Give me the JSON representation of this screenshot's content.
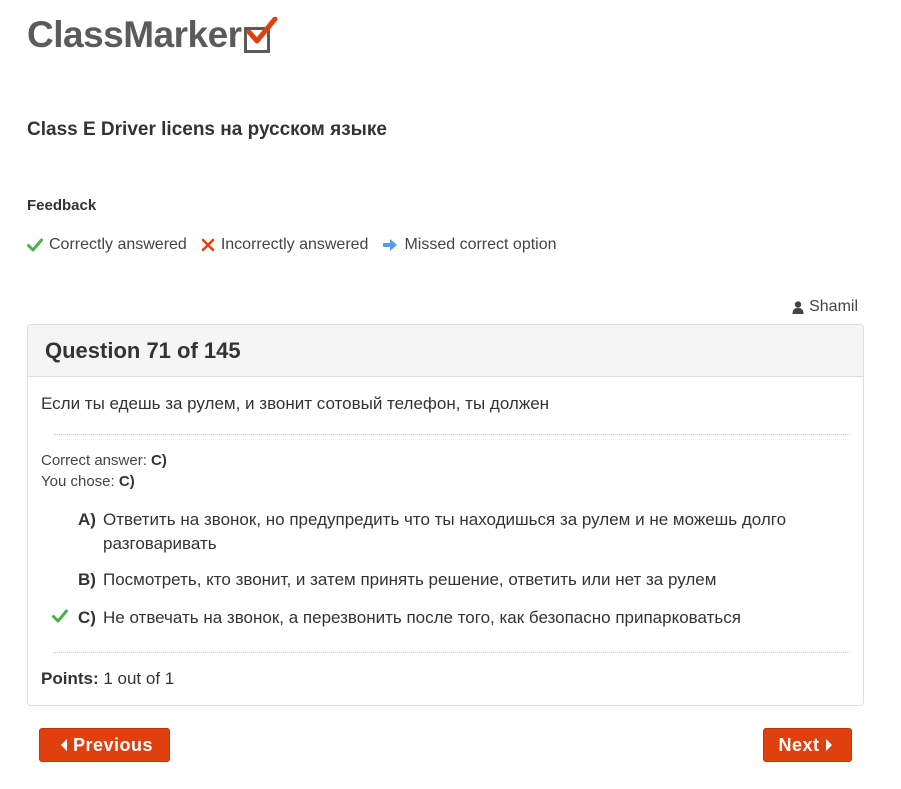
{
  "brand": {
    "name": "ClassMarker",
    "check_color": "#e0400e",
    "text_color": "#5b5b5b"
  },
  "test": {
    "title": "Class E Driver licens на русском языке"
  },
  "feedback": {
    "heading": "Feedback",
    "legend": [
      {
        "icon": "check-icon",
        "label": "Correctly answered",
        "color": "#4cae4c"
      },
      {
        "icon": "cross-icon",
        "label": "Incorrectly answered",
        "color": "#e0400e"
      },
      {
        "icon": "arrow-right-icon",
        "label": "Missed correct option",
        "color": "#4f9fe8"
      }
    ]
  },
  "user": {
    "icon": "user-icon",
    "name": "Shamil"
  },
  "question": {
    "heading": "Question 71 of 145",
    "text": "Если ты едешь за рулем, и звонит сотовый телефон, ты должен",
    "correct_answer_label": "Correct answer:",
    "correct_answer_value": "C)",
    "you_chose_label": "You chose:",
    "you_chose_value": "C)",
    "options": [
      {
        "letter": "A)",
        "text": "Ответить на звонок, но предупредить что ты находишься за рулем и не можешь долго разговаривать",
        "status": ""
      },
      {
        "letter": "B)",
        "text": "Посмотреть, кто звонит, и затем принять решение, ответить или нет за рулем",
        "status": ""
      },
      {
        "letter": "C)",
        "text": "Не отвечать на звонок, а перезвонить после того, как безопасно припарковаться",
        "status": "correct"
      }
    ],
    "points_label": "Points:",
    "points_value": "1 out of 1"
  },
  "nav": {
    "previous_label": "Previous",
    "next_label": "Next",
    "button_color": "#e0400e"
  }
}
